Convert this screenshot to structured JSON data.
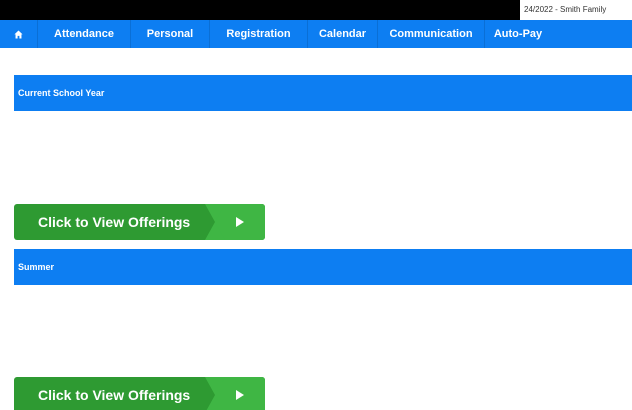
{
  "header": {
    "family_info": "24/2022 - Smith Family"
  },
  "nav": {
    "home_icon": "home-icon",
    "items": [
      {
        "label": "Attendance"
      },
      {
        "label": "Personal"
      },
      {
        "label": "Registration"
      },
      {
        "label": "Calendar"
      },
      {
        "label": "Communication"
      },
      {
        "label": "Auto-Pay"
      }
    ]
  },
  "sections": [
    {
      "title": "Current School Year",
      "button_label": "Click to View Offerings"
    },
    {
      "title": "Summer",
      "button_label": "Click to View Offerings"
    }
  ],
  "colors": {
    "nav_blue": "#0d7ef2",
    "button_green": "#2e9a32",
    "button_arrow_green": "#3fb644"
  }
}
